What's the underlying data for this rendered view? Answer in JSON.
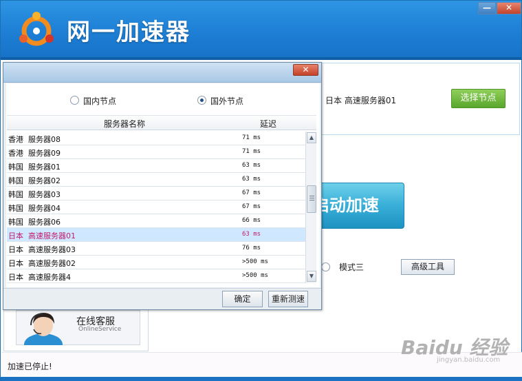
{
  "app": {
    "title": "网一加速器",
    "min_symbol": "—",
    "close_symbol": "✕"
  },
  "node": {
    "selected": "日本  高速服务器01",
    "choose_label": "选择节点"
  },
  "main": {
    "start_label": "启动加速",
    "mode3_label": "模式三",
    "advanced_label": "高级工具"
  },
  "service": {
    "label_cn": "在线客服",
    "label_en": "OnlineService"
  },
  "status": {
    "text": "加速已停止!"
  },
  "watermark": {
    "brand": "Baidu 经验",
    "url": "jingyan.baidu.com"
  },
  "dialog": {
    "close_symbol": "✕",
    "radio_domestic": "国内节点",
    "radio_foreign": "国外节点",
    "selected_radio": "foreign",
    "col_name": "服务器名称",
    "col_ping": "延迟",
    "servers": [
      {
        "name": "香港  服务器08",
        "ping": "71 ms"
      },
      {
        "name": "香港  服务器09",
        "ping": "71 ms"
      },
      {
        "name": "韩国  服务器01",
        "ping": "63 ms"
      },
      {
        "name": "韩国  服务器02",
        "ping": "63 ms"
      },
      {
        "name": "韩国  服务器03",
        "ping": "67 ms"
      },
      {
        "name": "韩国  服务器04",
        "ping": "67 ms"
      },
      {
        "name": "韩国  服务器06",
        "ping": "66 ms"
      },
      {
        "name": "日本  高速服务器01",
        "ping": "63 ms"
      },
      {
        "name": "日本  高速服务器03",
        "ping": "76 ms"
      },
      {
        "name": "日本  高速服务器02",
        "ping": ">500 ms"
      },
      {
        "name": "日本  高速服务器4",
        "ping": ">500 ms"
      }
    ],
    "selected_index": 7,
    "confirm_label": "确定",
    "retest_label": "重新测速"
  },
  "colors": {
    "title_bar": "#1d7ed4",
    "choose_button": "#6bb63b",
    "start_button": "#38aed8",
    "selected_row_text": "#c01d6a",
    "selected_row_bg": "#cfe7ff"
  }
}
